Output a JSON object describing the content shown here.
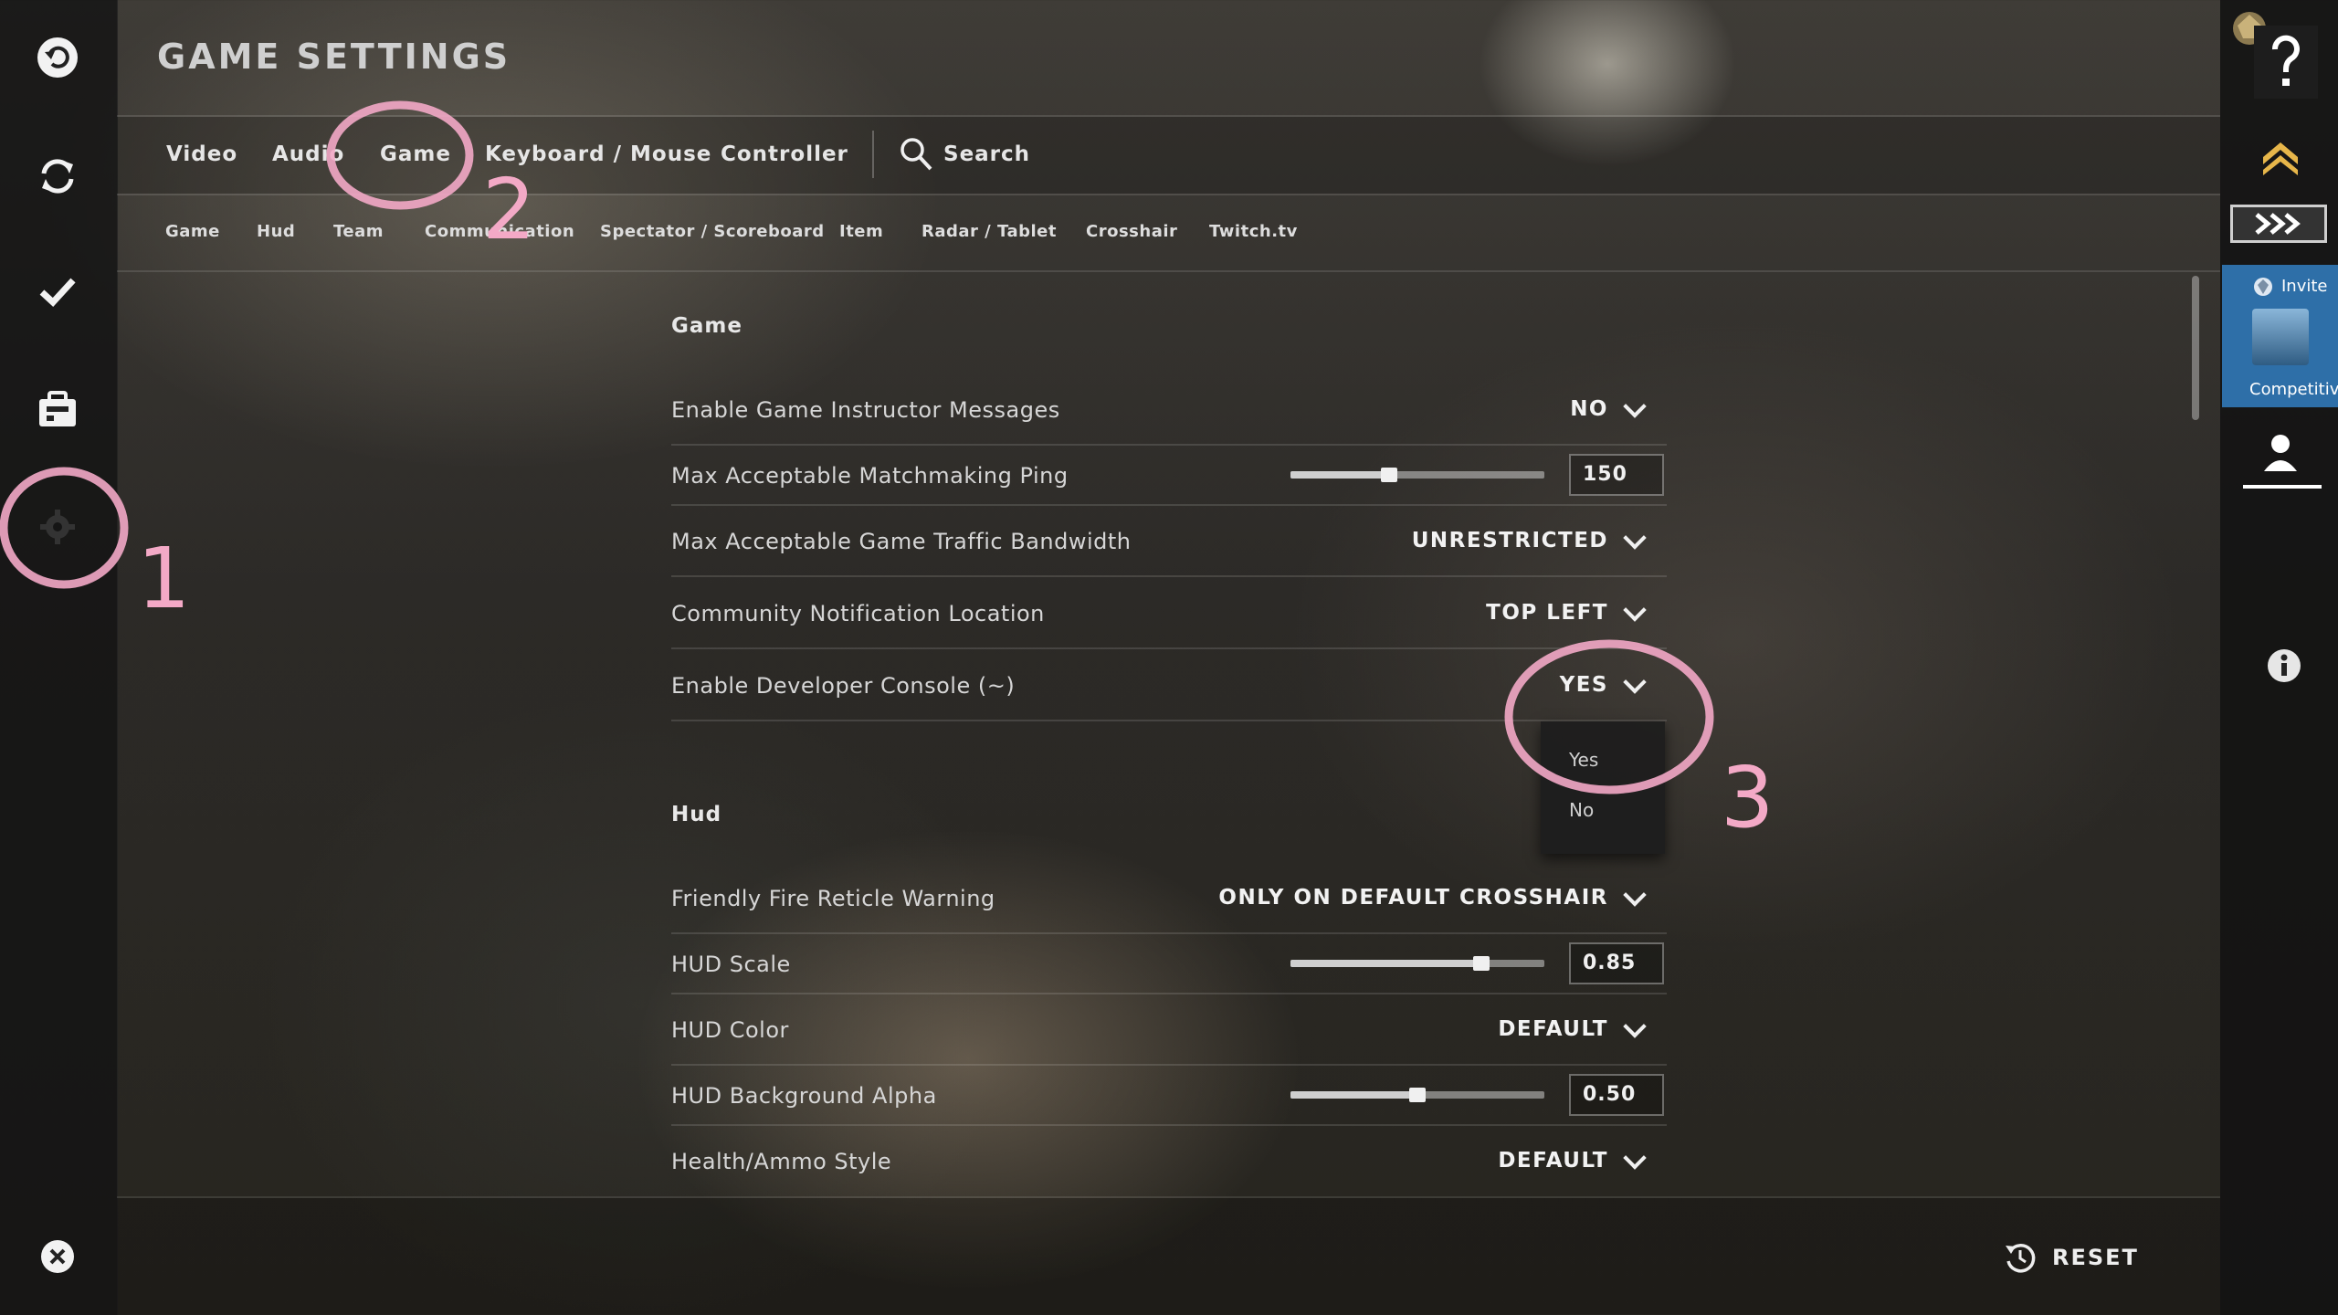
{
  "header": {
    "title": "GAME SETTINGS"
  },
  "tabs": [
    "Video",
    "Audio",
    "Game",
    "Keyboard / Mouse",
    "Controller"
  ],
  "search_label": "Search",
  "subtabs": [
    "Game",
    "Hud",
    "Team",
    "Communication",
    "Spectator / Scoreboard",
    "Item",
    "Radar / Tablet",
    "Crosshair",
    "Twitch.tv"
  ],
  "sections": {
    "game": {
      "title": "Game",
      "rows": [
        {
          "label": "Enable Game Instructor Messages",
          "value": "NO"
        },
        {
          "label": "Max Acceptable Matchmaking Ping",
          "value": "150",
          "level": 0.39
        },
        {
          "label": "Max Acceptable Game Traffic Bandwidth",
          "value": "UNRESTRICTED"
        },
        {
          "label": "Community Notification Location",
          "value": "TOP LEFT"
        },
        {
          "label": "Enable Developer Console (~)",
          "value": "YES"
        }
      ]
    },
    "hud": {
      "title": "Hud",
      "rows": [
        {
          "label": "Friendly Fire Reticle Warning",
          "value": "ONLY ON DEFAULT CROSSHAIR"
        },
        {
          "label": "HUD Scale",
          "value": "0.85",
          "level": 0.75
        },
        {
          "label": "HUD Color",
          "value": "DEFAULT"
        },
        {
          "label": "HUD Background Alpha",
          "value": "0.50",
          "level": 0.5
        },
        {
          "label": "Health/Ammo Style",
          "value": "DEFAULT"
        }
      ]
    }
  },
  "dropdown_options": [
    "Yes",
    "No"
  ],
  "reset_label": "RESET",
  "rightbar": {
    "invite": "Invite",
    "competitive": "Competitive"
  },
  "annotations": [
    "1",
    "2",
    "3"
  ],
  "colors": {
    "annotation": "#f3a9c6",
    "invite_card": "#2e6fa8"
  }
}
